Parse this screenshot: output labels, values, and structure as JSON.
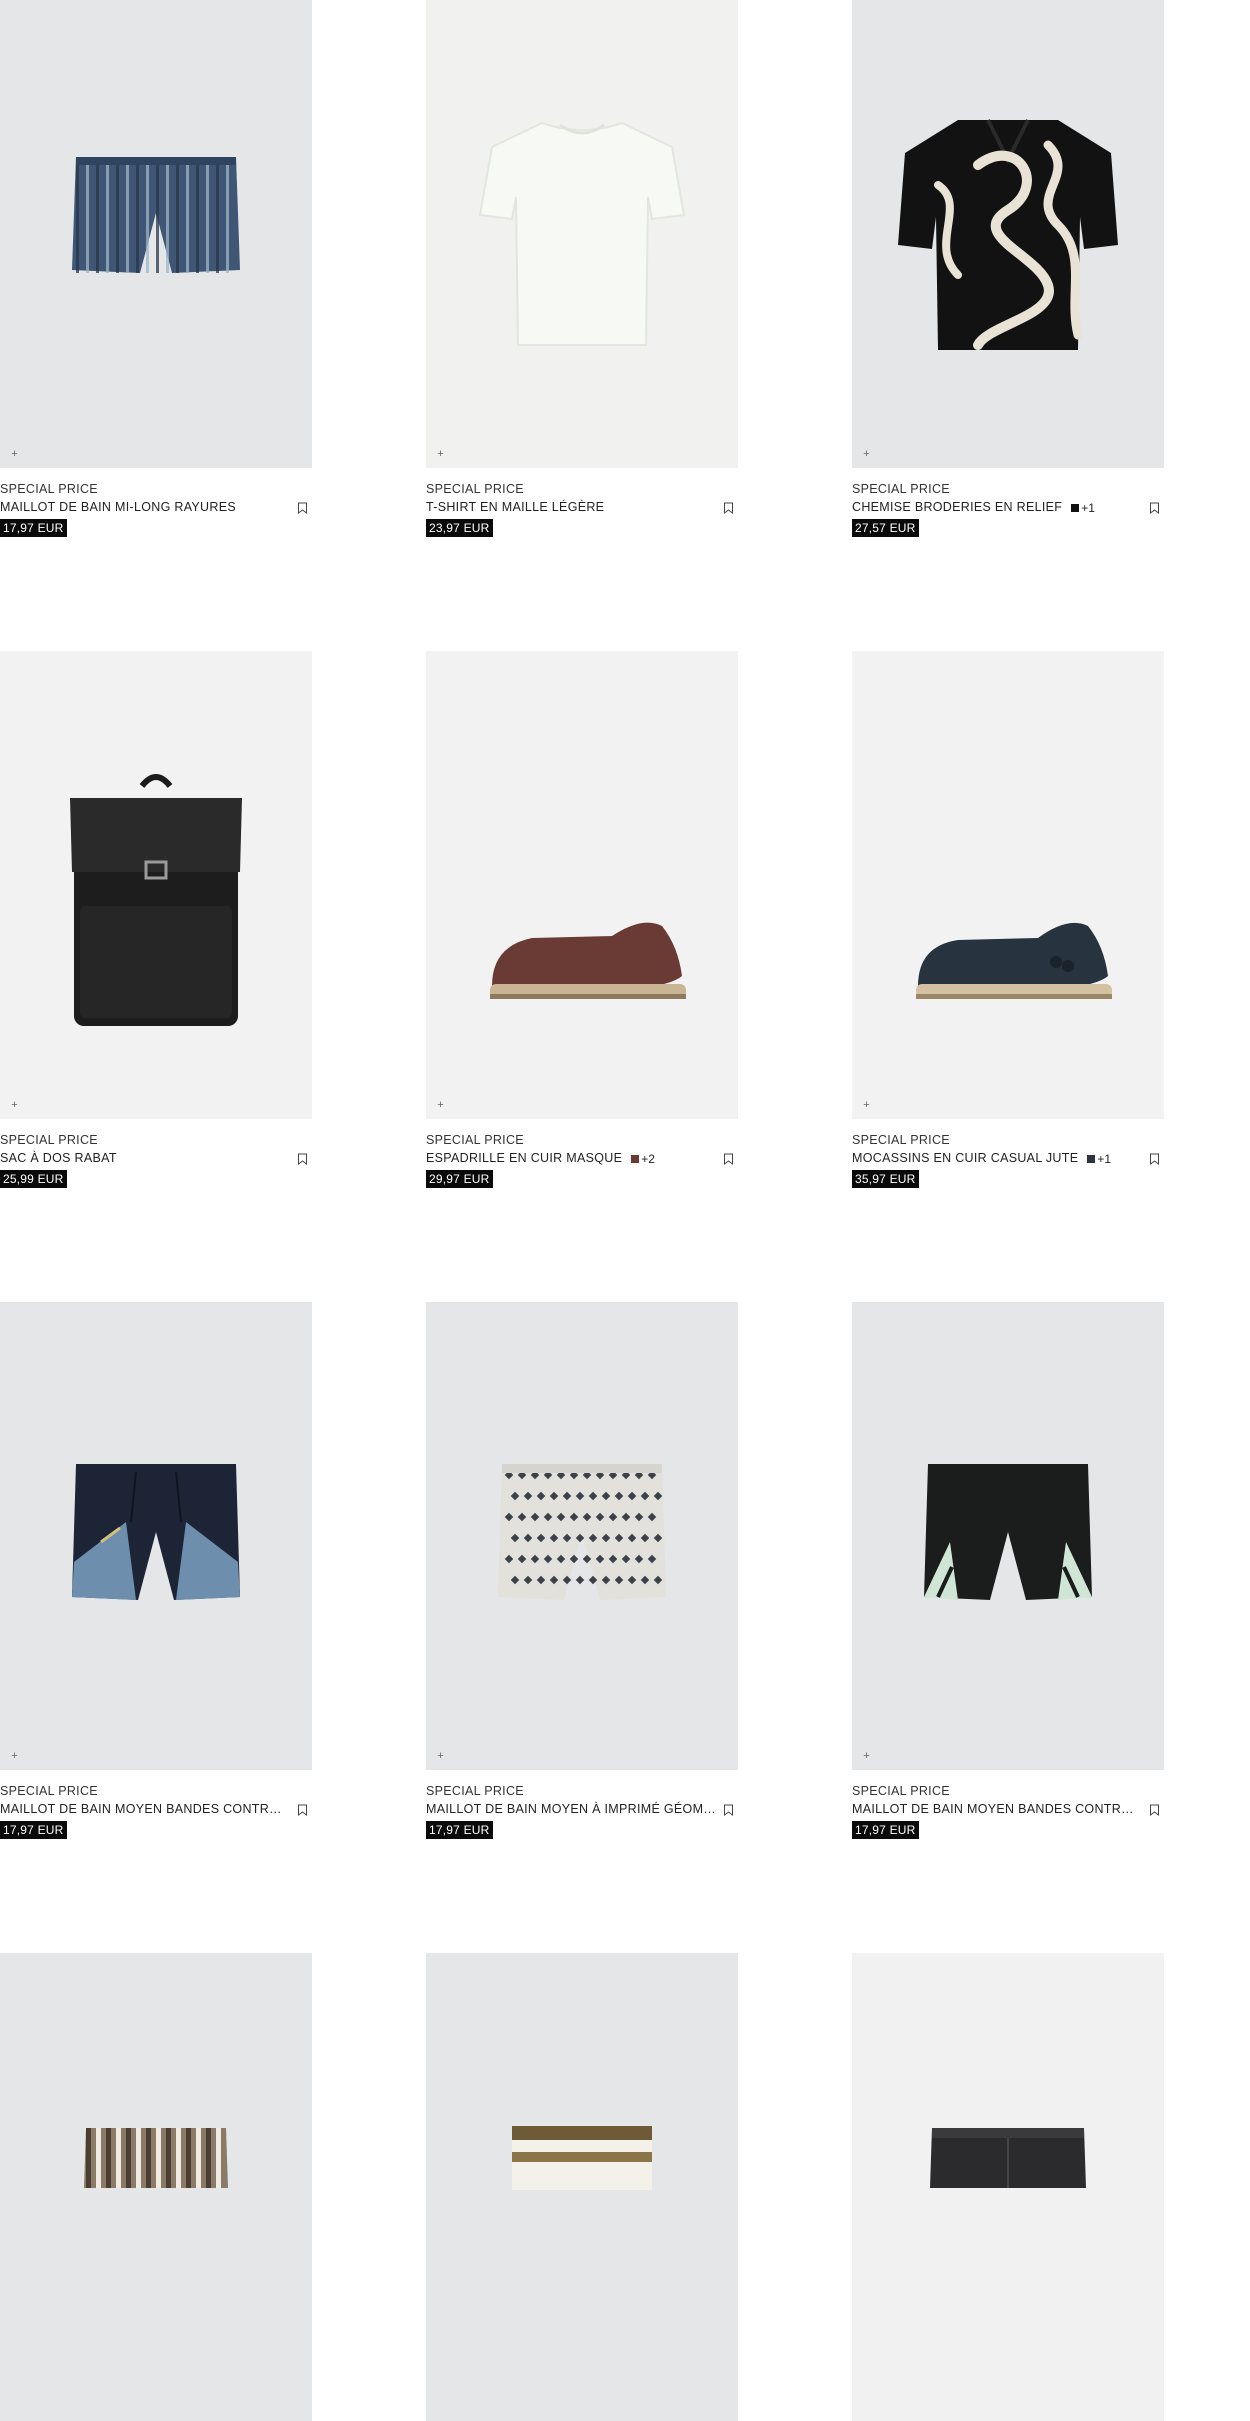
{
  "products": [
    {
      "tag": "SPECIAL PRICE",
      "name": "MAILLOT DE BAIN MI-LONG RAYURES",
      "price": "17,97 EUR",
      "bg": "#e4e6e7",
      "art": "shorts-stripes",
      "plus": "+",
      "swatch": null
    },
    {
      "tag": "SPECIAL PRICE",
      "name": "T-SHIRT EN MAILLE LÉGÈRE",
      "price": "23,97 EUR",
      "bg": "#f1f1f0",
      "art": "tshirt",
      "plus": "+",
      "swatch": null
    },
    {
      "tag": "SPECIAL PRICE",
      "name": "CHEMISE BRODERIES EN RELIEF",
      "price": "27,57 EUR",
      "bg": "#e4e6e7",
      "art": "shirt",
      "plus": "+",
      "swatch": {
        "color": "#111111",
        "more": "+1"
      }
    },
    {
      "tag": "SPECIAL PRICE",
      "name": "SAC À DOS RABAT",
      "price": "25,99 EUR",
      "bg": "#f2f2f2",
      "art": "backpack",
      "plus": "+",
      "swatch": null
    },
    {
      "tag": "SPECIAL PRICE",
      "name": "ESPADRILLE EN CUIR MASQUE",
      "price": "29,97 EUR",
      "bg": "#f2f2f2",
      "art": "espadrille-brown",
      "plus": "+",
      "swatch": {
        "color": "#6a3a35",
        "more": "+2"
      }
    },
    {
      "tag": "SPECIAL PRICE",
      "name": "MOCASSINS EN CUIR CASUAL JUTE",
      "price": "35,97 EUR",
      "bg": "#f2f2f2",
      "art": "loafer-navy",
      "plus": "+",
      "swatch": {
        "color": "#2a3540",
        "more": "+1"
      }
    },
    {
      "tag": "SPECIAL PRICE",
      "name": "MAILLOT DE BAIN MOYEN BANDES CONTRASTÉES",
      "price": "17,97 EUR",
      "bg": "#e4e6e7",
      "art": "shorts-navy",
      "plus": "+",
      "swatch": null
    },
    {
      "tag": "SPECIAL PRICE",
      "name": "MAILLOT DE BAIN MOYEN À IMPRIMÉ GÉOMÉTRIQUE",
      "price": "17,97 EUR",
      "bg": "#e4e6e7",
      "art": "shorts-print",
      "plus": "+",
      "swatch": null
    },
    {
      "tag": "SPECIAL PRICE",
      "name": "MAILLOT DE BAIN MOYEN BANDES CONTRASTÉES",
      "price": "17,97 EUR",
      "bg": "#e4e6e7",
      "art": "shorts-black",
      "plus": "+",
      "swatch": null
    },
    {
      "tag": "",
      "name": "",
      "price": "",
      "bg": "#e4e6e7",
      "art": "partial-stripes",
      "plus": "",
      "swatch": null
    },
    {
      "tag": "",
      "name": "",
      "price": "",
      "bg": "#e4e6e7",
      "art": "partial-waist",
      "plus": "",
      "swatch": null
    },
    {
      "tag": "",
      "name": "",
      "price": "",
      "bg": "#f1f1f1",
      "art": "partial-denim",
      "plus": "",
      "swatch": null
    }
  ]
}
